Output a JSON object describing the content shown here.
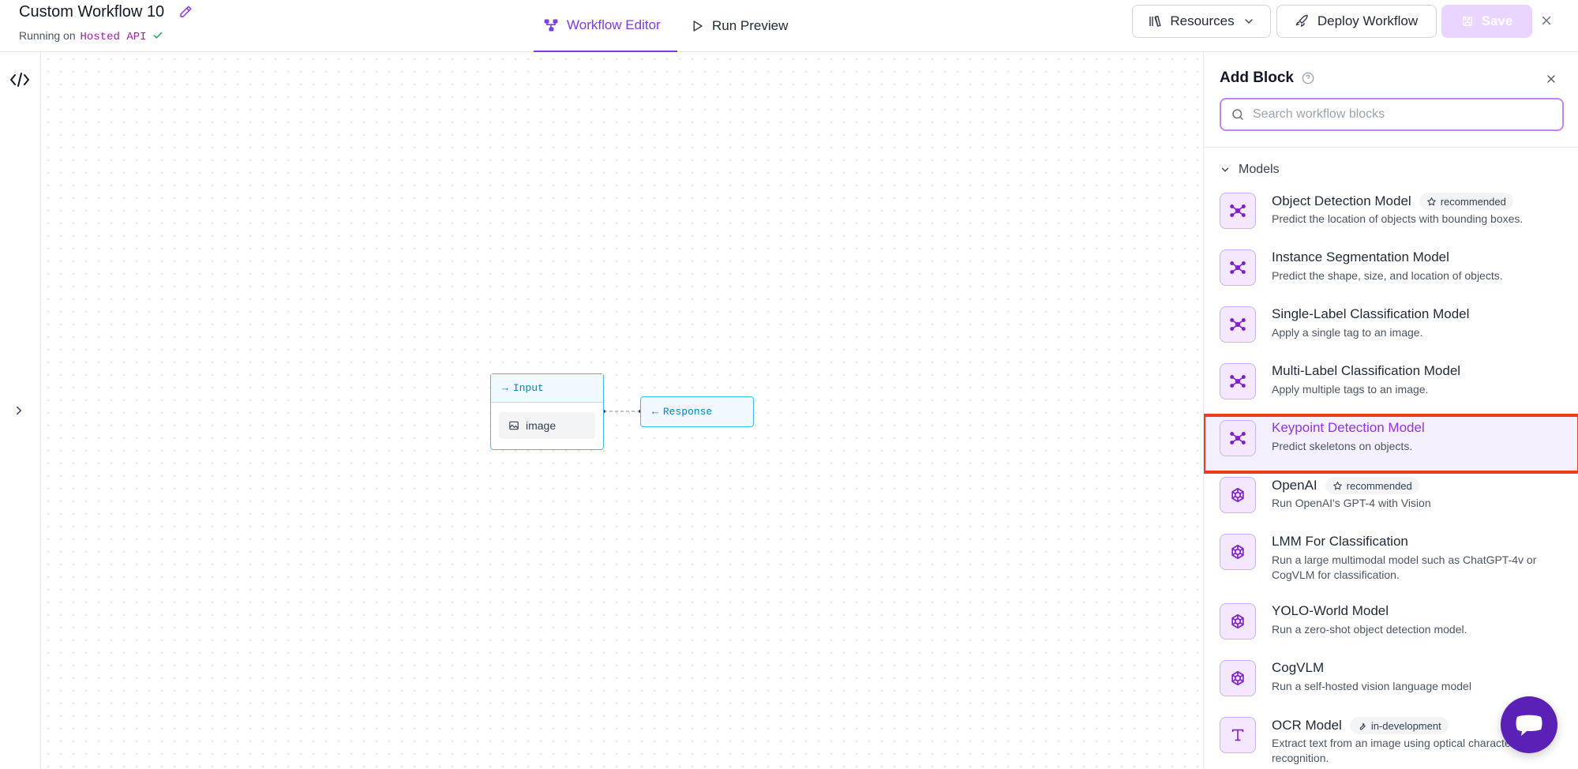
{
  "header": {
    "workflow_title": "Custom Workflow 10",
    "running_on_label": "Running on",
    "running_on_value": "Hosted API",
    "tabs": [
      {
        "label": "Workflow Editor",
        "active": true
      },
      {
        "label": "Run Preview",
        "active": false
      }
    ],
    "resources_label": "Resources",
    "deploy_label": "Deploy Workflow",
    "save_label": "Save"
  },
  "canvas": {
    "input_node": {
      "title": "Input",
      "param": "image"
    },
    "response_node": {
      "title": "Response"
    }
  },
  "panel": {
    "title": "Add Block",
    "search_placeholder": "Search workflow blocks",
    "section_label": "Models",
    "items": [
      {
        "name": "Object Detection Model",
        "badge": "recommended",
        "badge_icon": "star-icon",
        "description": "Predict the location of objects with bounding boxes.",
        "icon": "model-graph-icon"
      },
      {
        "name": "Instance Segmentation Model",
        "badge": "",
        "description": "Predict the shape, size, and location of objects.",
        "icon": "model-graph-icon"
      },
      {
        "name": "Single-Label Classification Model",
        "badge": "",
        "description": "Apply a single tag to an image.",
        "icon": "model-graph-icon"
      },
      {
        "name": "Multi-Label Classification Model",
        "badge": "",
        "description": "Apply multiple tags to an image.",
        "icon": "model-graph-icon"
      },
      {
        "name": "Keypoint Detection Model",
        "badge": "",
        "description": "Predict skeletons on objects.",
        "icon": "model-graph-icon",
        "selected": true
      },
      {
        "name": "OpenAI",
        "badge": "recommended",
        "badge_icon": "star-icon",
        "description": "Run OpenAI's GPT-4 with Vision",
        "icon": "openai-icon"
      },
      {
        "name": "LMM For Classification",
        "badge": "",
        "description": "Run a large multimodal model such as ChatGPT-4v or CogVLM for classification.",
        "icon": "openai-icon"
      },
      {
        "name": "YOLO-World Model",
        "badge": "",
        "description": "Run a zero-shot object detection model.",
        "icon": "openai-icon"
      },
      {
        "name": "CogVLM",
        "badge": "",
        "description": "Run a self-hosted vision language model",
        "icon": "openai-icon"
      },
      {
        "name": "OCR Model",
        "badge": "in-development",
        "badge_icon": "wrench-icon",
        "description": "Extract text from an image using optical character recognition.",
        "icon": "text-t-icon"
      }
    ]
  },
  "colors": {
    "accent": "#7c3aed",
    "node_border": "#38bdf8",
    "highlight_box": "#ef3a1f",
    "chat_button": "#5b21b6"
  }
}
